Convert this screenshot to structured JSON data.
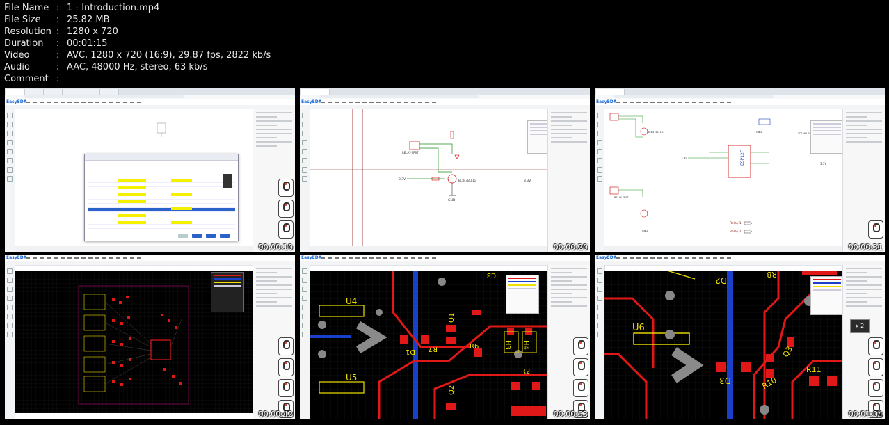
{
  "file_info": [
    {
      "key": "File Name",
      "value": "1 - Introduction.mp4"
    },
    {
      "key": "File Size",
      "value": "25.82 MB"
    },
    {
      "key": "Resolution",
      "value": "1280 x 720"
    },
    {
      "key": "Duration",
      "value": "00:01:15"
    },
    {
      "key": "Video",
      "value": "AVC, 1280 x 720 (16:9), 29.87 fps, 2822 kb/s"
    },
    {
      "key": "Audio",
      "value": "AAC, 48000 Hz, stereo, 63 kb/s"
    },
    {
      "key": "Comment",
      "value": ""
    }
  ],
  "separator": ":",
  "thumbnails": [
    {
      "timestamp": "00:00:10",
      "scene": "library-dialog"
    },
    {
      "timestamp": "00:00:20",
      "scene": "schematic-relay"
    },
    {
      "timestamp": "00:00:31",
      "scene": "schematic-esp"
    },
    {
      "timestamp": "00:00:42",
      "scene": "pcb-overview"
    },
    {
      "timestamp": "00:00:53",
      "scene": "pcb-zoom"
    },
    {
      "timestamp": "00:01:04",
      "scene": "pcb-zoom-2"
    }
  ],
  "app_logo": "EasyEDA",
  "zoom_badge": "x 2",
  "schematic_labels": {
    "relay": "RELAY-SPST",
    "gnd": "GND",
    "transistor": "BC847BLT1G",
    "esp": "ESP12F",
    "regulator": "TC1262-3.3",
    "v33": "3.3V",
    "relay1": "Relay 1",
    "relay2": "Relay 2"
  },
  "pcb_labels": {
    "u4": "U4",
    "u5": "U5",
    "u6": "U6",
    "d1": "D1",
    "d2": "D2",
    "d3": "D3",
    "q1": "Q1",
    "q2": "Q2",
    "q3": "Q3",
    "r2": "R2",
    "r6": "R6",
    "r7": "R7",
    "r8": "R8",
    "r10": "R10",
    "r11": "R11",
    "h3": "H3",
    "h4": "H4",
    "c3": "C3"
  },
  "colors": {
    "trace_red": "#e01818",
    "trace_blue": "#1a3fc8",
    "silk_yellow": "#f0e000",
    "wire_green": "#1f8f1f"
  }
}
